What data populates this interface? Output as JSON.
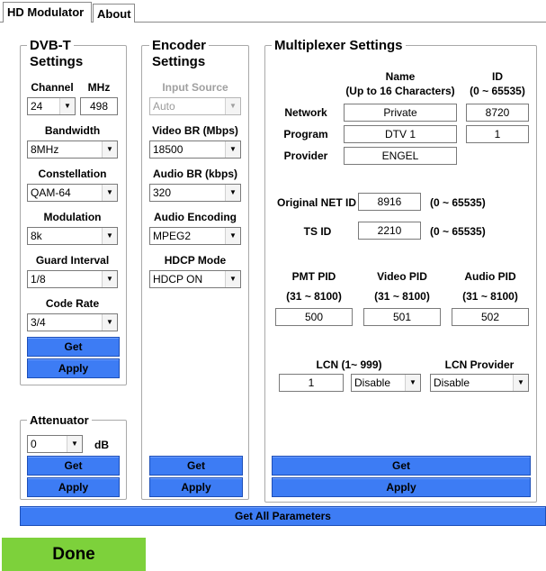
{
  "tabs": [
    {
      "label": "HD Modulator",
      "active": true
    },
    {
      "label": "About",
      "active": false
    }
  ],
  "dvbt": {
    "title_line1": "DVB-T",
    "title_line2": "Settings",
    "channel_label": "Channel",
    "mhz_label": "MHz",
    "channel_value": "24",
    "mhz_value": "498",
    "bandwidth_label": "Bandwidth",
    "bandwidth_value": "8MHz",
    "constellation_label": "Constellation",
    "constellation_value": "QAM-64",
    "modulation_label": "Modulation",
    "modulation_value": "8k",
    "guard_label": "Guard Interval",
    "guard_value": "1/8",
    "coderate_label": "Code Rate",
    "coderate_value": "3/4",
    "get_label": "Get",
    "apply_label": "Apply"
  },
  "attenuator": {
    "title": "Attenuator",
    "value": "0",
    "unit": "dB",
    "get_label": "Get",
    "apply_label": "Apply"
  },
  "encoder": {
    "title_line1": "Encoder",
    "title_line2": "Settings",
    "input_source_label": "Input Source",
    "input_source_value": "Auto",
    "video_br_label": "Video BR (Mbps)",
    "video_br_value": "18500",
    "audio_br_label": "Audio BR (kbps)",
    "audio_br_value": "320",
    "audio_enc_label": "Audio Encoding",
    "audio_enc_value": "MPEG2",
    "hdcp_label": "HDCP Mode",
    "hdcp_value": "HDCP ON",
    "get_label": "Get",
    "apply_label": "Apply"
  },
  "mux": {
    "title": "Multiplexer Settings",
    "name_header_1": "Name",
    "name_header_2": "(Up to 16 Characters)",
    "id_header_1": "ID",
    "id_header_2": "(0 ~ 65535)",
    "network_label": "Network",
    "network_name": "Private",
    "network_id": "8720",
    "program_label": "Program",
    "program_name": "DTV 1",
    "program_id": "1",
    "provider_label": "Provider",
    "provider_name": "ENGEL",
    "orig_net_label": "Original NET ID",
    "orig_net_value": "8916",
    "orig_net_range": "(0 ~ 65535)",
    "tsid_label": "TS ID",
    "tsid_value": "2210",
    "tsid_range": "(0 ~ 65535)",
    "pmt_label": "PMT PID",
    "pmt_range": "(31 ~ 8100)",
    "pmt_value": "500",
    "video_pid_label": "Video PID",
    "video_pid_range": "(31 ~ 8100)",
    "video_pid_value": "501",
    "audio_pid_label": "Audio PID",
    "audio_pid_range": "(31 ~ 8100)",
    "audio_pid_value": "502",
    "lcn_label": "LCN (1~ 999)",
    "lcn_value": "1",
    "lcn_mode_value": "Disable",
    "lcn_provider_label": "LCN Provider",
    "lcn_provider_value": "Disable",
    "get_label": "Get",
    "apply_label": "Apply"
  },
  "get_all_label": "Get All Parameters",
  "status": "Done",
  "colors": {
    "button_blue": "#3d7cf4",
    "done_green": "#7dd13b"
  }
}
